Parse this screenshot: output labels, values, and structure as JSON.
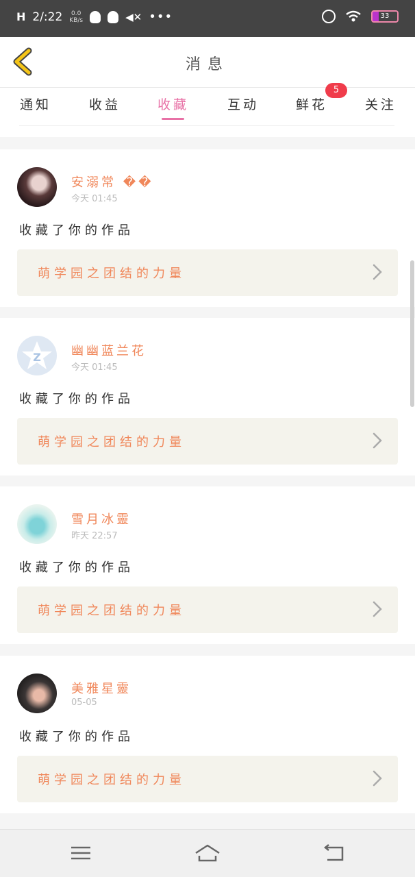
{
  "status_bar": {
    "signal": "H",
    "time": "2/:22",
    "net_speed_top": "0.0",
    "net_speed_bottom": "KB/s",
    "battery": "33",
    "icons": [
      "qq-icon",
      "qq-icon",
      "mute-icon",
      "more-dots-icon",
      "alarm-icon",
      "wifi-icon",
      "battery-icon"
    ]
  },
  "header": {
    "title": "消息",
    "back_icon": "chevron-left-icon"
  },
  "tabs": [
    {
      "label": "通知",
      "active": false
    },
    {
      "label": "收益",
      "active": false
    },
    {
      "label": "收藏",
      "active": true
    },
    {
      "label": "互动",
      "active": false
    },
    {
      "label": "鲜花",
      "active": false,
      "badge": "5"
    },
    {
      "label": "关注",
      "active": false
    }
  ],
  "notifications": [
    {
      "user": "安溺常 ��",
      "time": "今天 01:45",
      "action": "收藏了你的作品",
      "work_title": "萌学园之团结的力量"
    },
    {
      "user": "幽幽蓝兰花",
      "time": "今天 01:45",
      "action": "收藏了你的作品",
      "work_title": "萌学园之团结的力量"
    },
    {
      "user": "雪月冰靈",
      "time": "昨天 22:57",
      "action": "收藏了你的作品",
      "work_title": "萌学园之团结的力量"
    },
    {
      "user": "美雅星靈",
      "time": "05-05",
      "action": "收藏了你的作品",
      "work_title": "萌学园之团结的力量"
    }
  ],
  "colors": {
    "accent_pink": "#e871a6",
    "accent_orange": "#f0875a",
    "badge_red": "#f03c4b",
    "back_yellow": "#f5c518"
  },
  "nav_bar": {
    "icons": [
      "menu-icon",
      "home-icon",
      "back-icon"
    ]
  }
}
